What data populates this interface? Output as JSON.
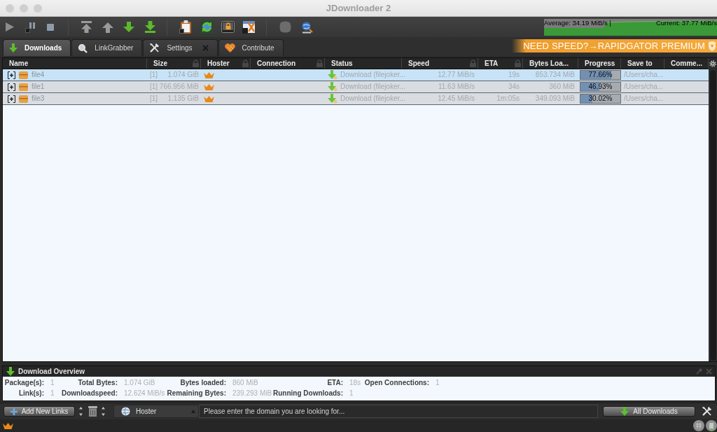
{
  "window": {
    "title": "JDownloader 2"
  },
  "speed_meter": {
    "average": "Average: 34.19 MiB/s |",
    "current": "Current: 37.77 MiB/s"
  },
  "tabs": [
    {
      "label": "Downloads",
      "selected": true,
      "closable": false
    },
    {
      "label": "LinkGrabber",
      "selected": false,
      "closable": false
    },
    {
      "label": "Settings",
      "selected": false,
      "closable": true
    },
    {
      "label": "Contribute",
      "selected": false,
      "closable": false
    }
  ],
  "banner": {
    "text": "NEED SPEED?→RAPIDGATOR PREMIUM"
  },
  "table": {
    "columns": [
      {
        "label": "Name",
        "locked": false
      },
      {
        "label": "Size",
        "locked": true
      },
      {
        "label": "Hoster",
        "locked": true
      },
      {
        "label": "Connection",
        "locked": true
      },
      {
        "label": "Status",
        "locked": false
      },
      {
        "label": "Speed",
        "locked": true
      },
      {
        "label": "ETA",
        "locked": true
      },
      {
        "label": "Bytes Loa...",
        "locked": false
      },
      {
        "label": "Progress",
        "locked": false
      },
      {
        "label": "Save to",
        "locked": false
      },
      {
        "label": "Comme...",
        "locked": false
      }
    ],
    "rows": [
      {
        "selected": true,
        "expanded": false,
        "name": "file4",
        "links": "[1]",
        "size": "1.074 GiB",
        "status": "Download (filejoker...",
        "speed": "12.77 MiB/s",
        "eta": "19s",
        "bytes_loaded": "853.734 MiB",
        "progress": "77.66%",
        "level": 0.7766,
        "save_to": "/Users/cha..."
      },
      {
        "selected": false,
        "expanded": false,
        "name": "file1",
        "links": "[1]",
        "size": "766.956 MiB",
        "status": "Download (filejoker...",
        "speed": "11.63 MiB/s",
        "eta": "34s",
        "bytes_loaded": "360 MiB",
        "progress": "46.93%",
        "level": 0.4693,
        "save_to": "/Users/cha..."
      },
      {
        "selected": false,
        "expanded": false,
        "name": "file3",
        "links": "[1]",
        "size": "1.135 GiB",
        "status": "Download (filejoker...",
        "speed": "12.45 MiB/s",
        "eta": "1m:05s",
        "bytes_loaded": "349.093 MiB",
        "progress": "30.02%",
        "level": 0.3002,
        "save_to": "/Users/cha..."
      }
    ]
  },
  "overview": {
    "title": "Download Overview",
    "rows": [
      [
        {
          "label": "Package(s):",
          "value": "1"
        },
        {
          "label": "Total Bytes:",
          "value": "1.074 GiB"
        },
        {
          "label": "Bytes loaded:",
          "value": "860 MiB"
        },
        {
          "label": "ETA:",
          "value": "18s"
        },
        {
          "label": "Open Connections:",
          "value": "1"
        }
      ],
      [
        {
          "label": "Link(s):",
          "value": "1"
        },
        {
          "label": "Downloadspeed:",
          "value": "12.624 MiB/s"
        },
        {
          "label": "Remaining Bytes:",
          "value": "239.293 MiB"
        },
        {
          "label": "Running Downloads:",
          "value": "1"
        }
      ]
    ]
  },
  "bottom_bar": {
    "add_button": "Add New Links",
    "filter": "Hoster",
    "search": {
      "placeholder": "Please enter the domain you are looking for..."
    },
    "view_button": "All Downloads"
  }
}
